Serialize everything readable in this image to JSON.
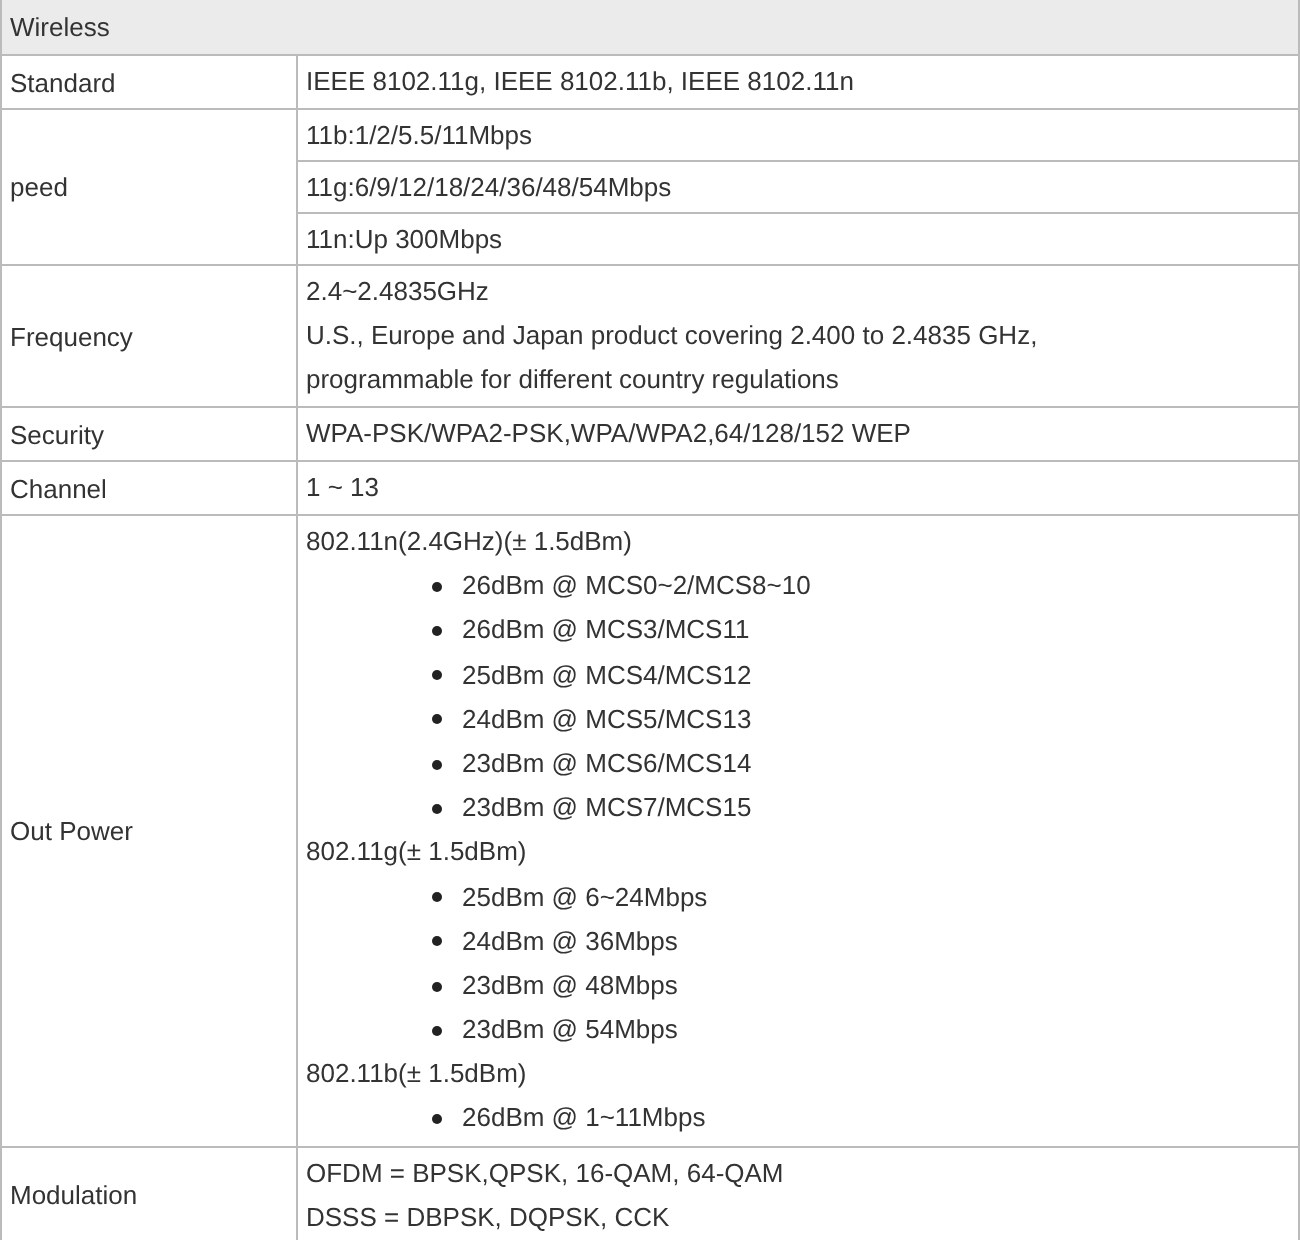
{
  "section": "Wireless",
  "rows": [
    {
      "label": "Standard",
      "kind": "text",
      "lines": [
        "IEEE 8102.11g, IEEE 8102.11b, IEEE 8102.11n"
      ]
    },
    {
      "label": "peed",
      "kind": "split",
      "lines": [
        "11b:1/2/5.5/11Mbps",
        "11g:6/9/12/18/24/36/48/54Mbps",
        "11n:Up 300Mbps"
      ]
    },
    {
      "label": "Frequency",
      "kind": "text",
      "lines": [
        "2.4~2.4835GHz",
        "U.S., Europe and Japan product covering 2.400 to 2.4835 GHz,",
        "programmable for different country regulations"
      ]
    },
    {
      "label": "Security",
      "kind": "text",
      "lines": [
        "WPA-PSK/WPA2-PSK,WPA/WPA2,64/128/152 WEP"
      ]
    },
    {
      "label": "Channel",
      "kind": "text",
      "lines": [
        "1 ~ 13"
      ]
    },
    {
      "label": "Out Power",
      "kind": "groups",
      "groups": [
        {
          "heading": "802.11n(2.4GHz)(± 1.5dBm)",
          "items": [
            "26dBm @ MCS0~2/MCS8~10",
            "26dBm @ MCS3/MCS11",
            "25dBm @ MCS4/MCS12",
            "24dBm @ MCS5/MCS13",
            "23dBm @ MCS6/MCS14",
            "23dBm @ MCS7/MCS15"
          ]
        },
        {
          "heading": "802.11g(± 1.5dBm)",
          "items": [
            "25dBm @ 6~24Mbps",
            "24dBm @ 36Mbps",
            "23dBm @ 48Mbps",
            "23dBm @ 54Mbps"
          ]
        },
        {
          "heading": "802.11b(± 1.5dBm)",
          "items": [
            "26dBm @ 1~11Mbps"
          ]
        }
      ]
    },
    {
      "label": "Modulation",
      "kind": "text",
      "lines": [
        "OFDM = BPSK,QPSK, 16-QAM, 64-QAM",
        "DSSS = DBPSK, DQPSK, CCK"
      ]
    }
  ]
}
